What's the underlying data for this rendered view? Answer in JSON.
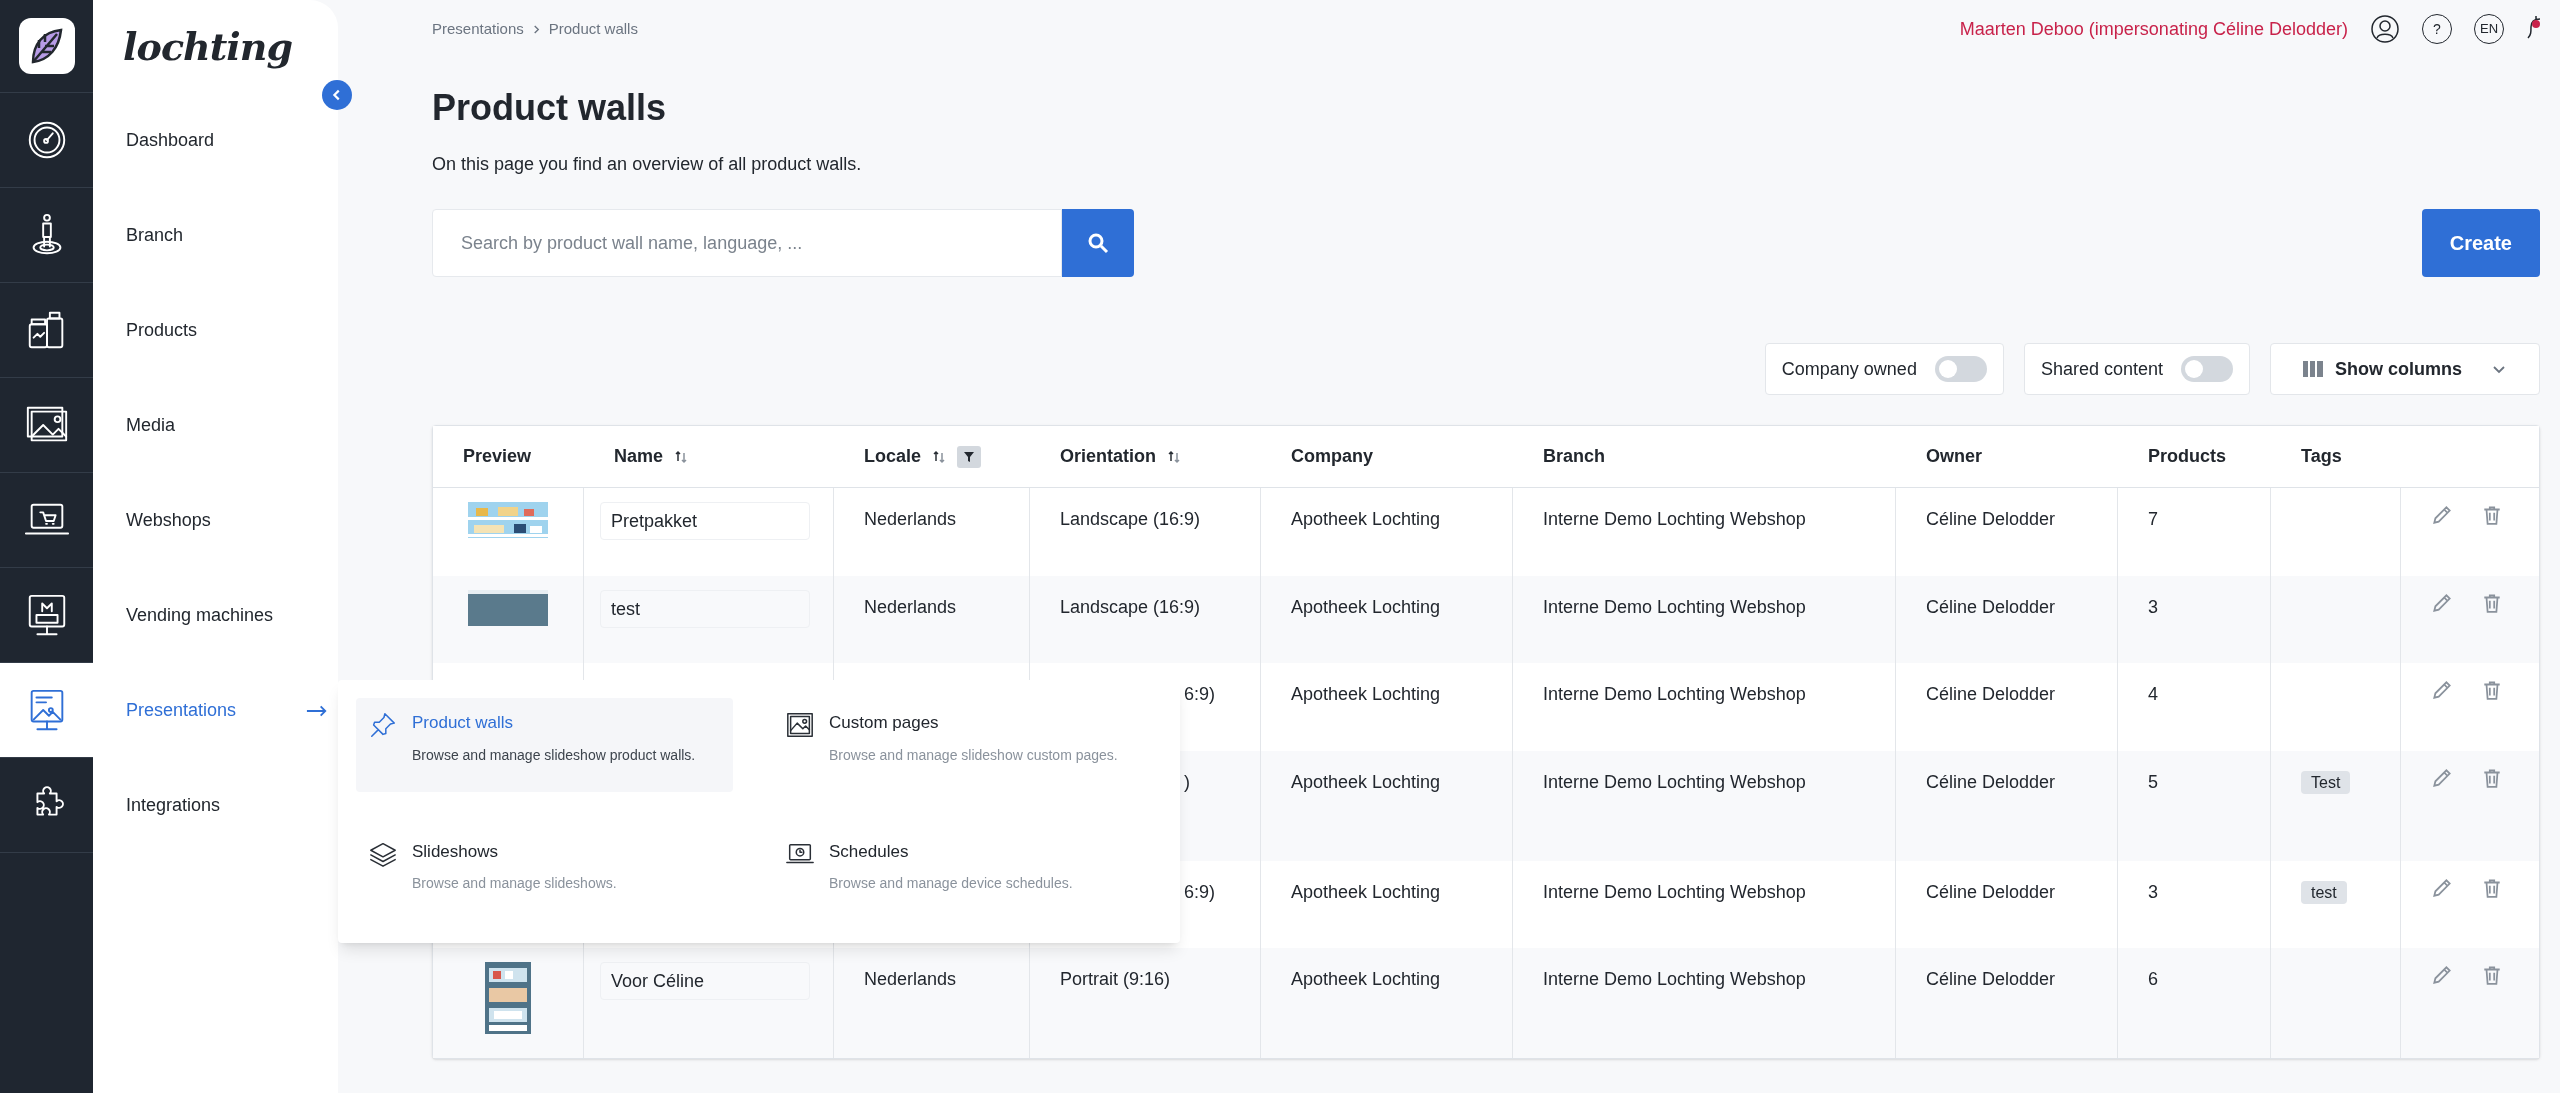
{
  "brand": {
    "logo_text": "lochting"
  },
  "nav": [
    {
      "label": "Dashboard",
      "selected": false
    },
    {
      "label": "Branch",
      "selected": false
    },
    {
      "label": "Products",
      "selected": false
    },
    {
      "label": "Media",
      "selected": false
    },
    {
      "label": "Webshops",
      "selected": false
    },
    {
      "label": "Vending machines",
      "selected": false
    },
    {
      "label": "Presentations",
      "selected": true
    },
    {
      "label": "Integrations",
      "selected": false
    }
  ],
  "breadcrumb": [
    "Presentations",
    "Product walls"
  ],
  "user": {
    "name": "Maarten Deboo (impersonating Céline Delodder)",
    "help": "?",
    "language": "EN",
    "notification": true
  },
  "page": {
    "title": "Product walls",
    "subtitle": "On this page you find an overview of all product walls."
  },
  "search": {
    "placeholder": "Search by product wall name, language, ..."
  },
  "create_button": "Create",
  "toggles": [
    {
      "label": "Company owned",
      "on": false
    },
    {
      "label": "Shared content",
      "on": false
    }
  ],
  "show_columns": "Show columns",
  "submenu": [
    {
      "title": "Product walls",
      "description": "Browse and manage slideshow product walls.",
      "selected": true
    },
    {
      "title": "Custom pages",
      "description": "Browse and manage slideshow custom pages.",
      "selected": false
    },
    {
      "title": "Slideshows",
      "description": "Browse and manage slideshows.",
      "selected": false
    },
    {
      "title": "Schedules",
      "description": "Browse and manage device schedules.",
      "selected": false
    }
  ],
  "table": {
    "columns": [
      {
        "label": "Preview",
        "sortable": false,
        "filter": false
      },
      {
        "label": "Name",
        "sortable": true,
        "filter": false
      },
      {
        "label": "Locale",
        "sortable": true,
        "filter": true
      },
      {
        "label": "Orientation",
        "sortable": true,
        "filter": false
      },
      {
        "label": "Company",
        "sortable": false,
        "filter": false
      },
      {
        "label": "Branch",
        "sortable": false,
        "filter": false
      },
      {
        "label": "Owner",
        "sortable": false,
        "filter": false
      },
      {
        "label": "Products",
        "sortable": false,
        "filter": false
      },
      {
        "label": "Tags",
        "sortable": false,
        "filter": false
      }
    ],
    "rows": [
      {
        "covered": false,
        "name": "Pretpakket",
        "locale": "Nederlands",
        "orientation": "Landscape (16:9)",
        "company": "Apotheek Lochting",
        "branch": "Interne Demo Lochting Webshop",
        "owner": "Céline Delodder",
        "products": "7"
      },
      {
        "covered": false,
        "name": "test",
        "locale": "Nederlands",
        "orientation": "Landscape (16:9)",
        "company": "Apotheek Lochting",
        "branch": "Interne Demo Lochting Webshop",
        "owner": "Céline Delodder",
        "products": "3"
      },
      {
        "covered": true,
        "orientation": "6:9)",
        "company": "Apotheek Lochting",
        "branch": "Interne Demo Lochting Webshop",
        "owner": "Céline Delodder",
        "products": "4"
      },
      {
        "covered": true,
        "orientation": ")",
        "company": "Apotheek Lochting",
        "branch": "Interne Demo Lochting Webshop",
        "owner": "Céline Delodder",
        "products": "5",
        "tag": "Test"
      },
      {
        "covered": true,
        "orientation": "6:9)",
        "company": "Apotheek Lochting",
        "branch": "Interne Demo Lochting Webshop",
        "owner": "Céline Delodder",
        "products": "3",
        "tag": "test"
      },
      {
        "covered": false,
        "name": "Voor Céline",
        "locale": "Nederlands",
        "orientation": "Portrait (9:16)",
        "company": "Apotheek Lochting",
        "branch": "Interne Demo Lochting Webshop",
        "owner": "Céline Delodder",
        "products": "6"
      }
    ]
  }
}
